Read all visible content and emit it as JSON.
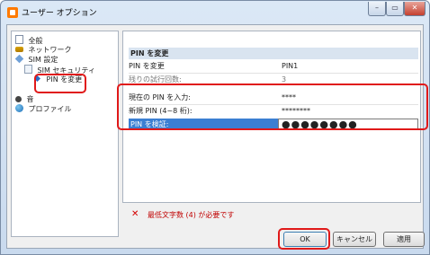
{
  "window": {
    "title": "ユーザー オプション",
    "controls": [
      "–",
      "▭",
      "✕"
    ]
  },
  "tree": {
    "items": [
      {
        "label": "全般",
        "icon": "document-icon"
      },
      {
        "label": "ネットワーク",
        "icon": "network-icon"
      },
      {
        "label": "SIM 設定",
        "icon": "sim-icon"
      },
      {
        "label": "SIM セキュリティ",
        "icon": "sim-security-icon"
      },
      {
        "label": "PIN を変更",
        "icon": "pin-change-icon"
      },
      {
        "label": "音",
        "icon": "sound-icon"
      },
      {
        "label": "プロファイル",
        "icon": "profile-icon"
      }
    ]
  },
  "panel": {
    "section_header": "PIN を変更",
    "rows": [
      {
        "label": "PIN を変更",
        "value": "PIN1"
      },
      {
        "label": "残りの試行回数:",
        "value": "3"
      },
      {
        "label": "現在の PIN を入力:",
        "value": "****"
      },
      {
        "label": "新規 PIN (4~8 桁):",
        "value": "********"
      }
    ],
    "verify": {
      "label": "PIN を検証:",
      "value": "●●●●●●●●"
    }
  },
  "error": {
    "icon": "✕",
    "text": "最低文字数 (4) が必要です",
    "color": "#d40000"
  },
  "buttons": {
    "ok": "OK",
    "cancel": "キャンセル",
    "apply": "適用"
  },
  "colors": {
    "annotation": "#e01919",
    "selection": "#3b7fd2"
  }
}
